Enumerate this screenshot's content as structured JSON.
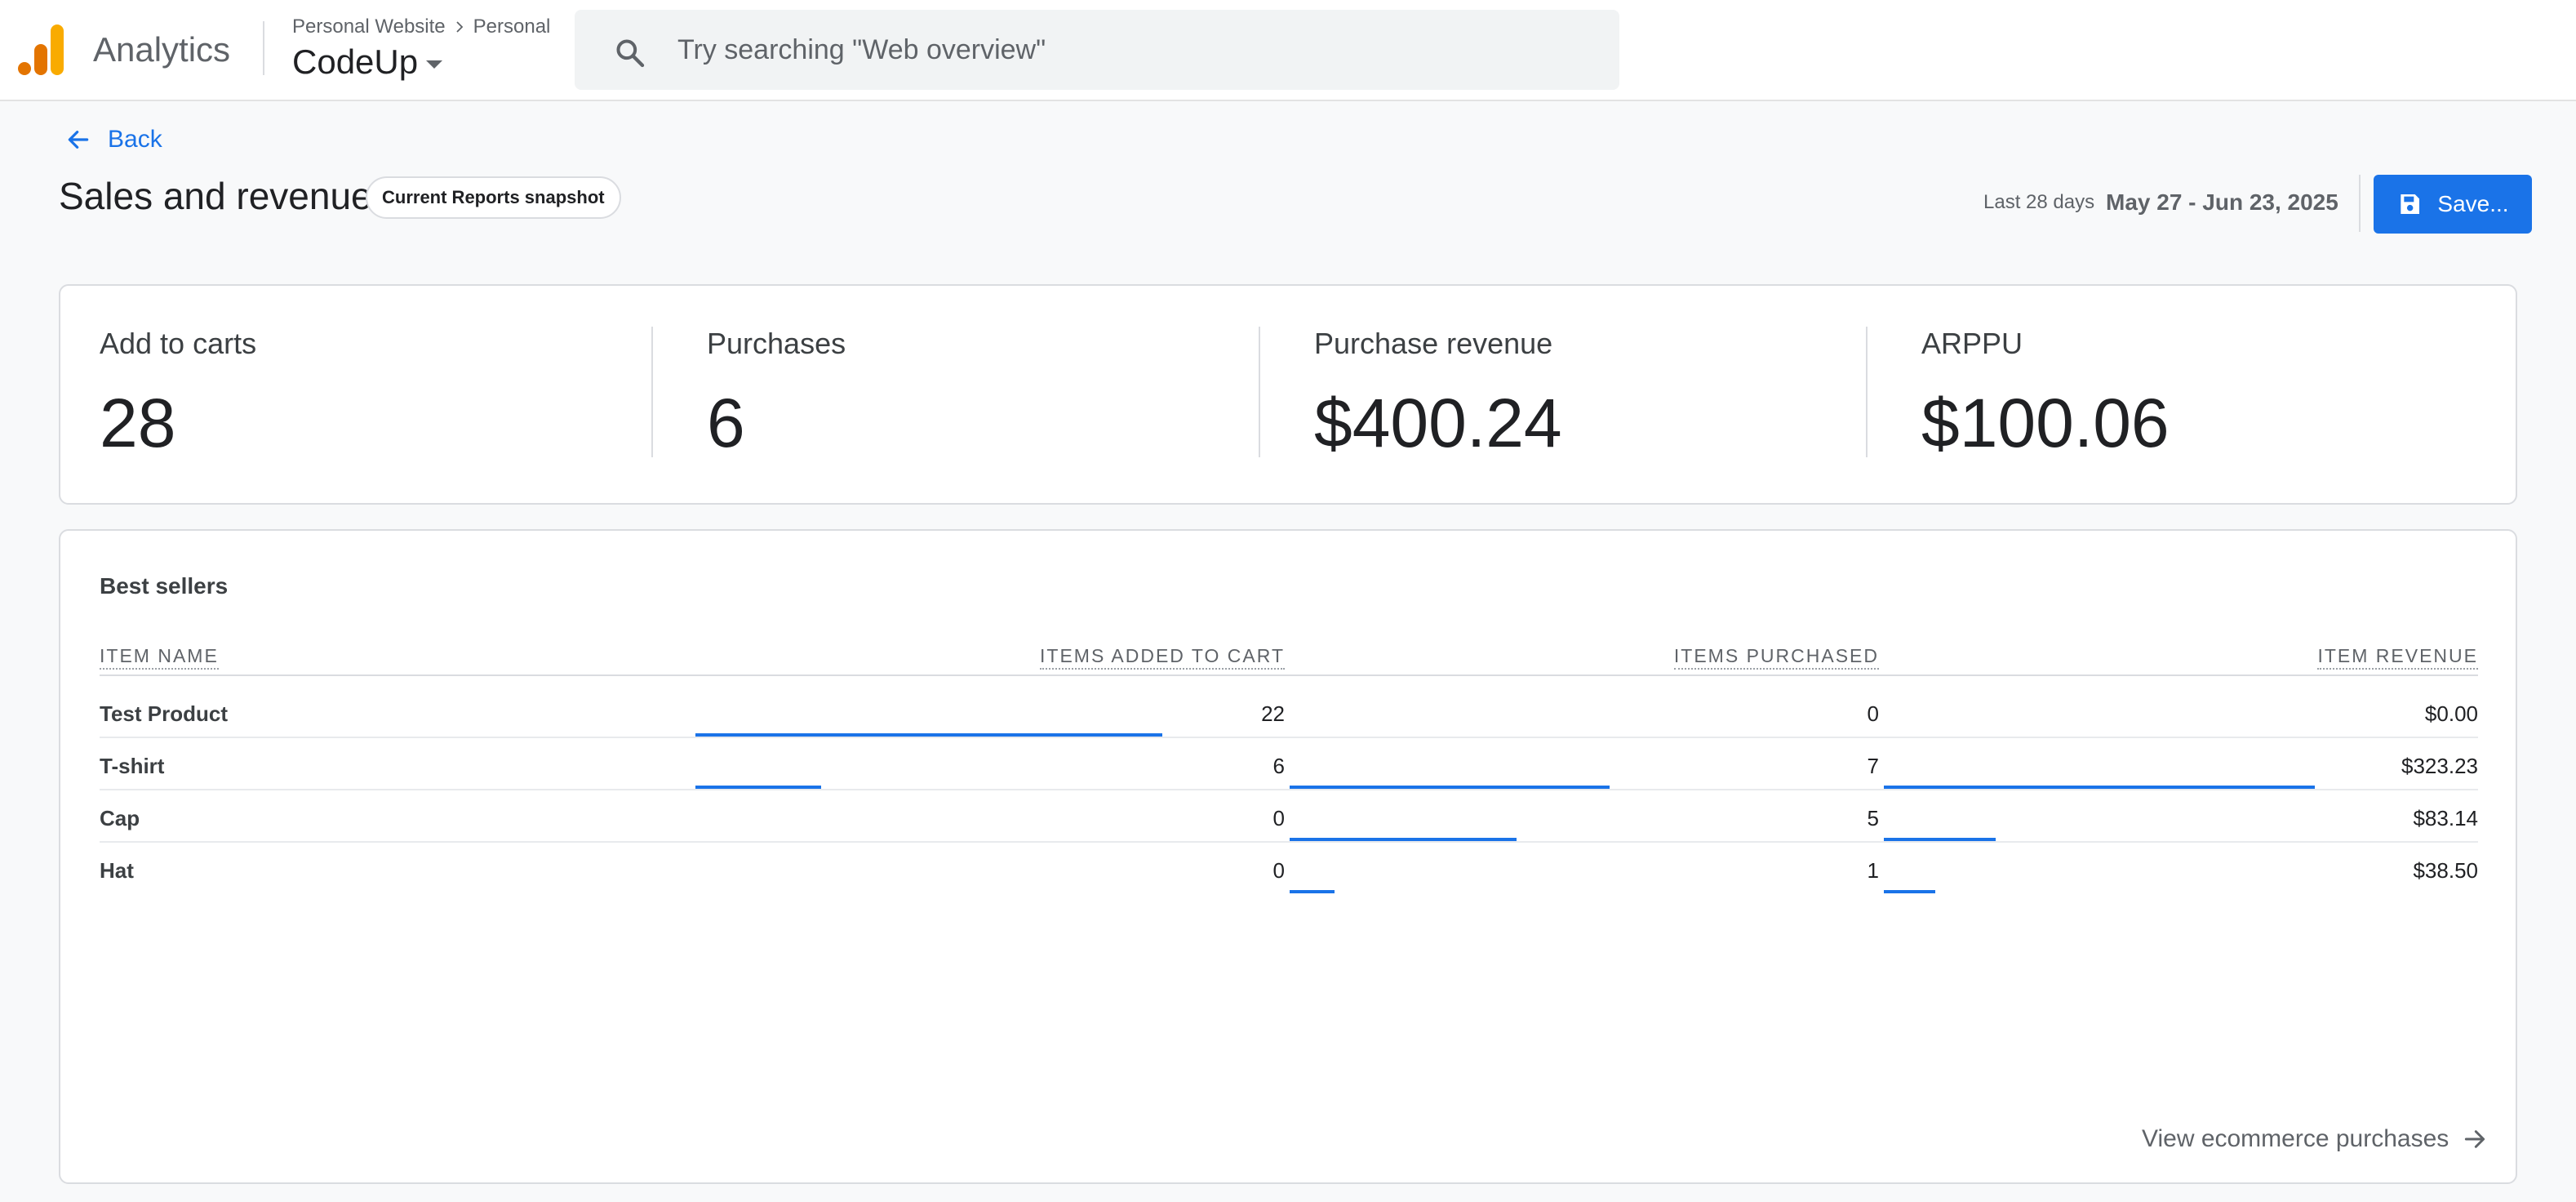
{
  "app": {
    "title": "Analytics",
    "breadcrumb": {
      "account": "Personal Website",
      "property_group": "Personal"
    },
    "property": "CodeUp"
  },
  "search": {
    "placeholder": "Try searching \"Web overview\""
  },
  "header": {
    "back_label": "Back",
    "title": "Sales and revenue",
    "snapshot_chip": "Current Reports snapshot",
    "date_label": "Last 28 days",
    "date_range": "May 27 - Jun 23, 2025",
    "save_label": "Save..."
  },
  "kpis": [
    {
      "label": "Add to carts",
      "value": "28"
    },
    {
      "label": "Purchases",
      "value": "6"
    },
    {
      "label": "Purchase revenue",
      "value": "$400.24"
    },
    {
      "label": "ARPPU",
      "value": "$100.06"
    }
  ],
  "best_sellers": {
    "title": "Best sellers",
    "columns": [
      "ITEM NAME",
      "ITEMS ADDED TO CART",
      "ITEMS PURCHASED",
      "ITEM REVENUE"
    ],
    "rows": [
      {
        "name": "Test Product",
        "added": "22",
        "purchased": "0",
        "revenue": "$0.00"
      },
      {
        "name": "T-shirt",
        "added": "6",
        "purchased": "7",
        "revenue": "$323.23"
      },
      {
        "name": "Cap",
        "added": "0",
        "purchased": "5",
        "revenue": "$83.14"
      },
      {
        "name": "Hat",
        "added": "0",
        "purchased": "1",
        "revenue": "$38.50"
      }
    ],
    "bar_fractions": {
      "added": [
        1.0,
        0.27,
        0,
        0
      ],
      "purchased": [
        0,
        1.0,
        0.71,
        0.14
      ],
      "revenue": [
        0,
        1.0,
        0.26,
        0.12
      ]
    },
    "view_link": "View ecommerce purchases"
  },
  "colors": {
    "accent": "#1a73e8",
    "logo_orange": "#e37400",
    "logo_yellow": "#f9ab00"
  }
}
